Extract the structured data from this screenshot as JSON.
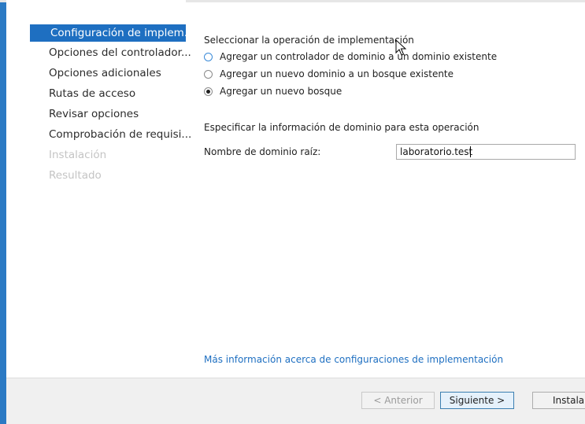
{
  "sidebar": {
    "items": [
      {
        "label": "Configuración de implem...",
        "state": "active"
      },
      {
        "label": "Opciones del controlador...",
        "state": "normal"
      },
      {
        "label": "Opciones adicionales",
        "state": "normal"
      },
      {
        "label": "Rutas de acceso",
        "state": "normal"
      },
      {
        "label": "Revisar opciones",
        "state": "normal"
      },
      {
        "label": "Comprobación de requisi...",
        "state": "normal"
      },
      {
        "label": "Instalación",
        "state": "disabled"
      },
      {
        "label": "Resultado",
        "state": "disabled"
      }
    ]
  },
  "main": {
    "operation_heading": "Seleccionar la operación de implementación",
    "options": [
      {
        "label": "Agregar un controlador de dominio a un dominio existente",
        "checked": false
      },
      {
        "label": "Agregar un nuevo dominio a un bosque existente",
        "checked": false
      },
      {
        "label": "Agregar un nuevo bosque",
        "checked": true
      }
    ],
    "domain_info_heading": "Especificar la información de dominio para esta operación",
    "root_domain_label": "Nombre de dominio raíz:",
    "root_domain_value": "laboratorio.test",
    "more_info_link": "Más información acerca de configuraciones de implementación"
  },
  "footer": {
    "previous_label": "< Anterior",
    "next_label": "Siguiente >",
    "install_label": "Instalar"
  },
  "colors": {
    "accent": "#1e6fc1",
    "window_border": "#2b7ac4",
    "disabled_text": "#c4c4c4"
  }
}
